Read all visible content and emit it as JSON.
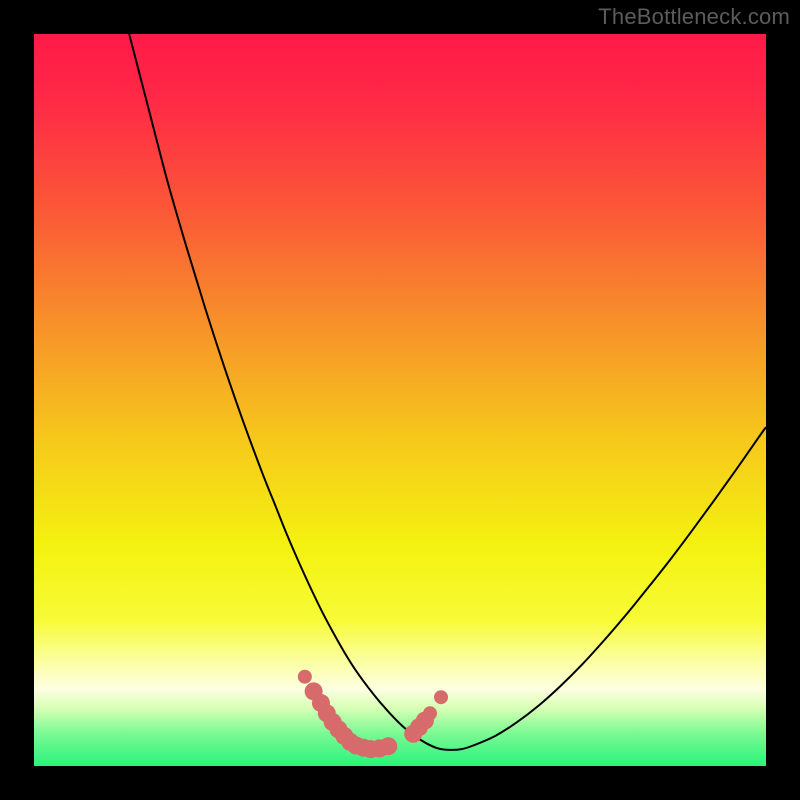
{
  "watermark": "TheBottleneck.com",
  "chart_data": {
    "type": "line",
    "title": "",
    "xlabel": "",
    "ylabel": "",
    "xlim": [
      0,
      100
    ],
    "ylim": [
      0,
      100
    ],
    "gradient_stops": [
      {
        "offset": 0.0,
        "color": "#ff1a49"
      },
      {
        "offset": 0.09,
        "color": "#ff2946"
      },
      {
        "offset": 0.24,
        "color": "#fb5837"
      },
      {
        "offset": 0.39,
        "color": "#f78f2a"
      },
      {
        "offset": 0.55,
        "color": "#f6c71c"
      },
      {
        "offset": 0.7,
        "color": "#f4f210"
      },
      {
        "offset": 0.8,
        "color": "#f7fb36"
      },
      {
        "offset": 0.86,
        "color": "#fbffa7"
      },
      {
        "offset": 0.895,
        "color": "#fdffe0"
      },
      {
        "offset": 0.92,
        "color": "#d9ffb6"
      },
      {
        "offset": 0.955,
        "color": "#7cf993"
      },
      {
        "offset": 1.0,
        "color": "#29f37c"
      }
    ],
    "series": [
      {
        "name": "bottleneck-curve",
        "color": "#000000",
        "stroke_width": 2,
        "x": [
          13.0,
          15.6,
          18.2,
          20.8,
          23.4,
          26.0,
          28.6,
          31.2,
          33.0,
          34.6,
          36.2,
          37.8,
          39.4,
          41.0,
          42.6,
          44.0,
          45.6,
          47.2,
          48.8,
          50.4,
          52.0,
          53.6,
          55.2,
          56.8,
          58.4,
          60.0,
          63.0,
          66.0,
          69.0,
          72.0,
          75.0,
          78.0,
          81.0,
          84.0,
          87.0,
          90.0,
          93.0,
          96.0,
          99.0,
          100.0
        ],
        "y": [
          100.0,
          90.0,
          80.0,
          71.0,
          62.5,
          54.5,
          47.0,
          40.0,
          35.5,
          31.5,
          27.8,
          24.3,
          21.0,
          18.0,
          15.2,
          13.0,
          10.8,
          8.8,
          7.0,
          5.4,
          4.1,
          3.1,
          2.4,
          2.2,
          2.3,
          2.8,
          4.1,
          6.0,
          8.3,
          11.0,
          14.0,
          17.3,
          20.8,
          24.5,
          28.3,
          32.3,
          36.4,
          40.6,
          44.9,
          46.3
        ]
      }
    ],
    "marker_groups": [
      {
        "name": "left-cluster",
        "color": "#d76a6a",
        "radius_small": 7,
        "radius_large": 9,
        "points": [
          {
            "x": 37.0,
            "y": 12.2,
            "r": "small"
          },
          {
            "x": 38.2,
            "y": 10.2,
            "r": "large"
          },
          {
            "x": 39.2,
            "y": 8.6,
            "r": "large"
          },
          {
            "x": 40.0,
            "y": 7.2,
            "r": "large"
          },
          {
            "x": 40.8,
            "y": 6.0,
            "r": "large"
          },
          {
            "x": 41.6,
            "y": 5.0,
            "r": "large"
          },
          {
            "x": 42.4,
            "y": 4.1,
            "r": "large"
          },
          {
            "x": 43.2,
            "y": 3.3,
            "r": "large"
          },
          {
            "x": 44.0,
            "y": 2.8,
            "r": "large"
          },
          {
            "x": 45.0,
            "y": 2.5,
            "r": "large"
          },
          {
            "x": 46.0,
            "y": 2.3,
            "r": "large"
          },
          {
            "x": 47.2,
            "y": 2.4,
            "r": "large"
          },
          {
            "x": 48.4,
            "y": 2.7,
            "r": "large"
          }
        ]
      },
      {
        "name": "right-cluster",
        "color": "#d76a6a",
        "radius_small": 7,
        "radius_large": 9,
        "points": [
          {
            "x": 51.8,
            "y": 4.4,
            "r": "large"
          },
          {
            "x": 52.6,
            "y": 5.3,
            "r": "large"
          },
          {
            "x": 53.4,
            "y": 6.2,
            "r": "large"
          },
          {
            "x": 54.1,
            "y": 7.2,
            "r": "small"
          },
          {
            "x": 55.6,
            "y": 9.4,
            "r": "small"
          }
        ]
      }
    ]
  }
}
